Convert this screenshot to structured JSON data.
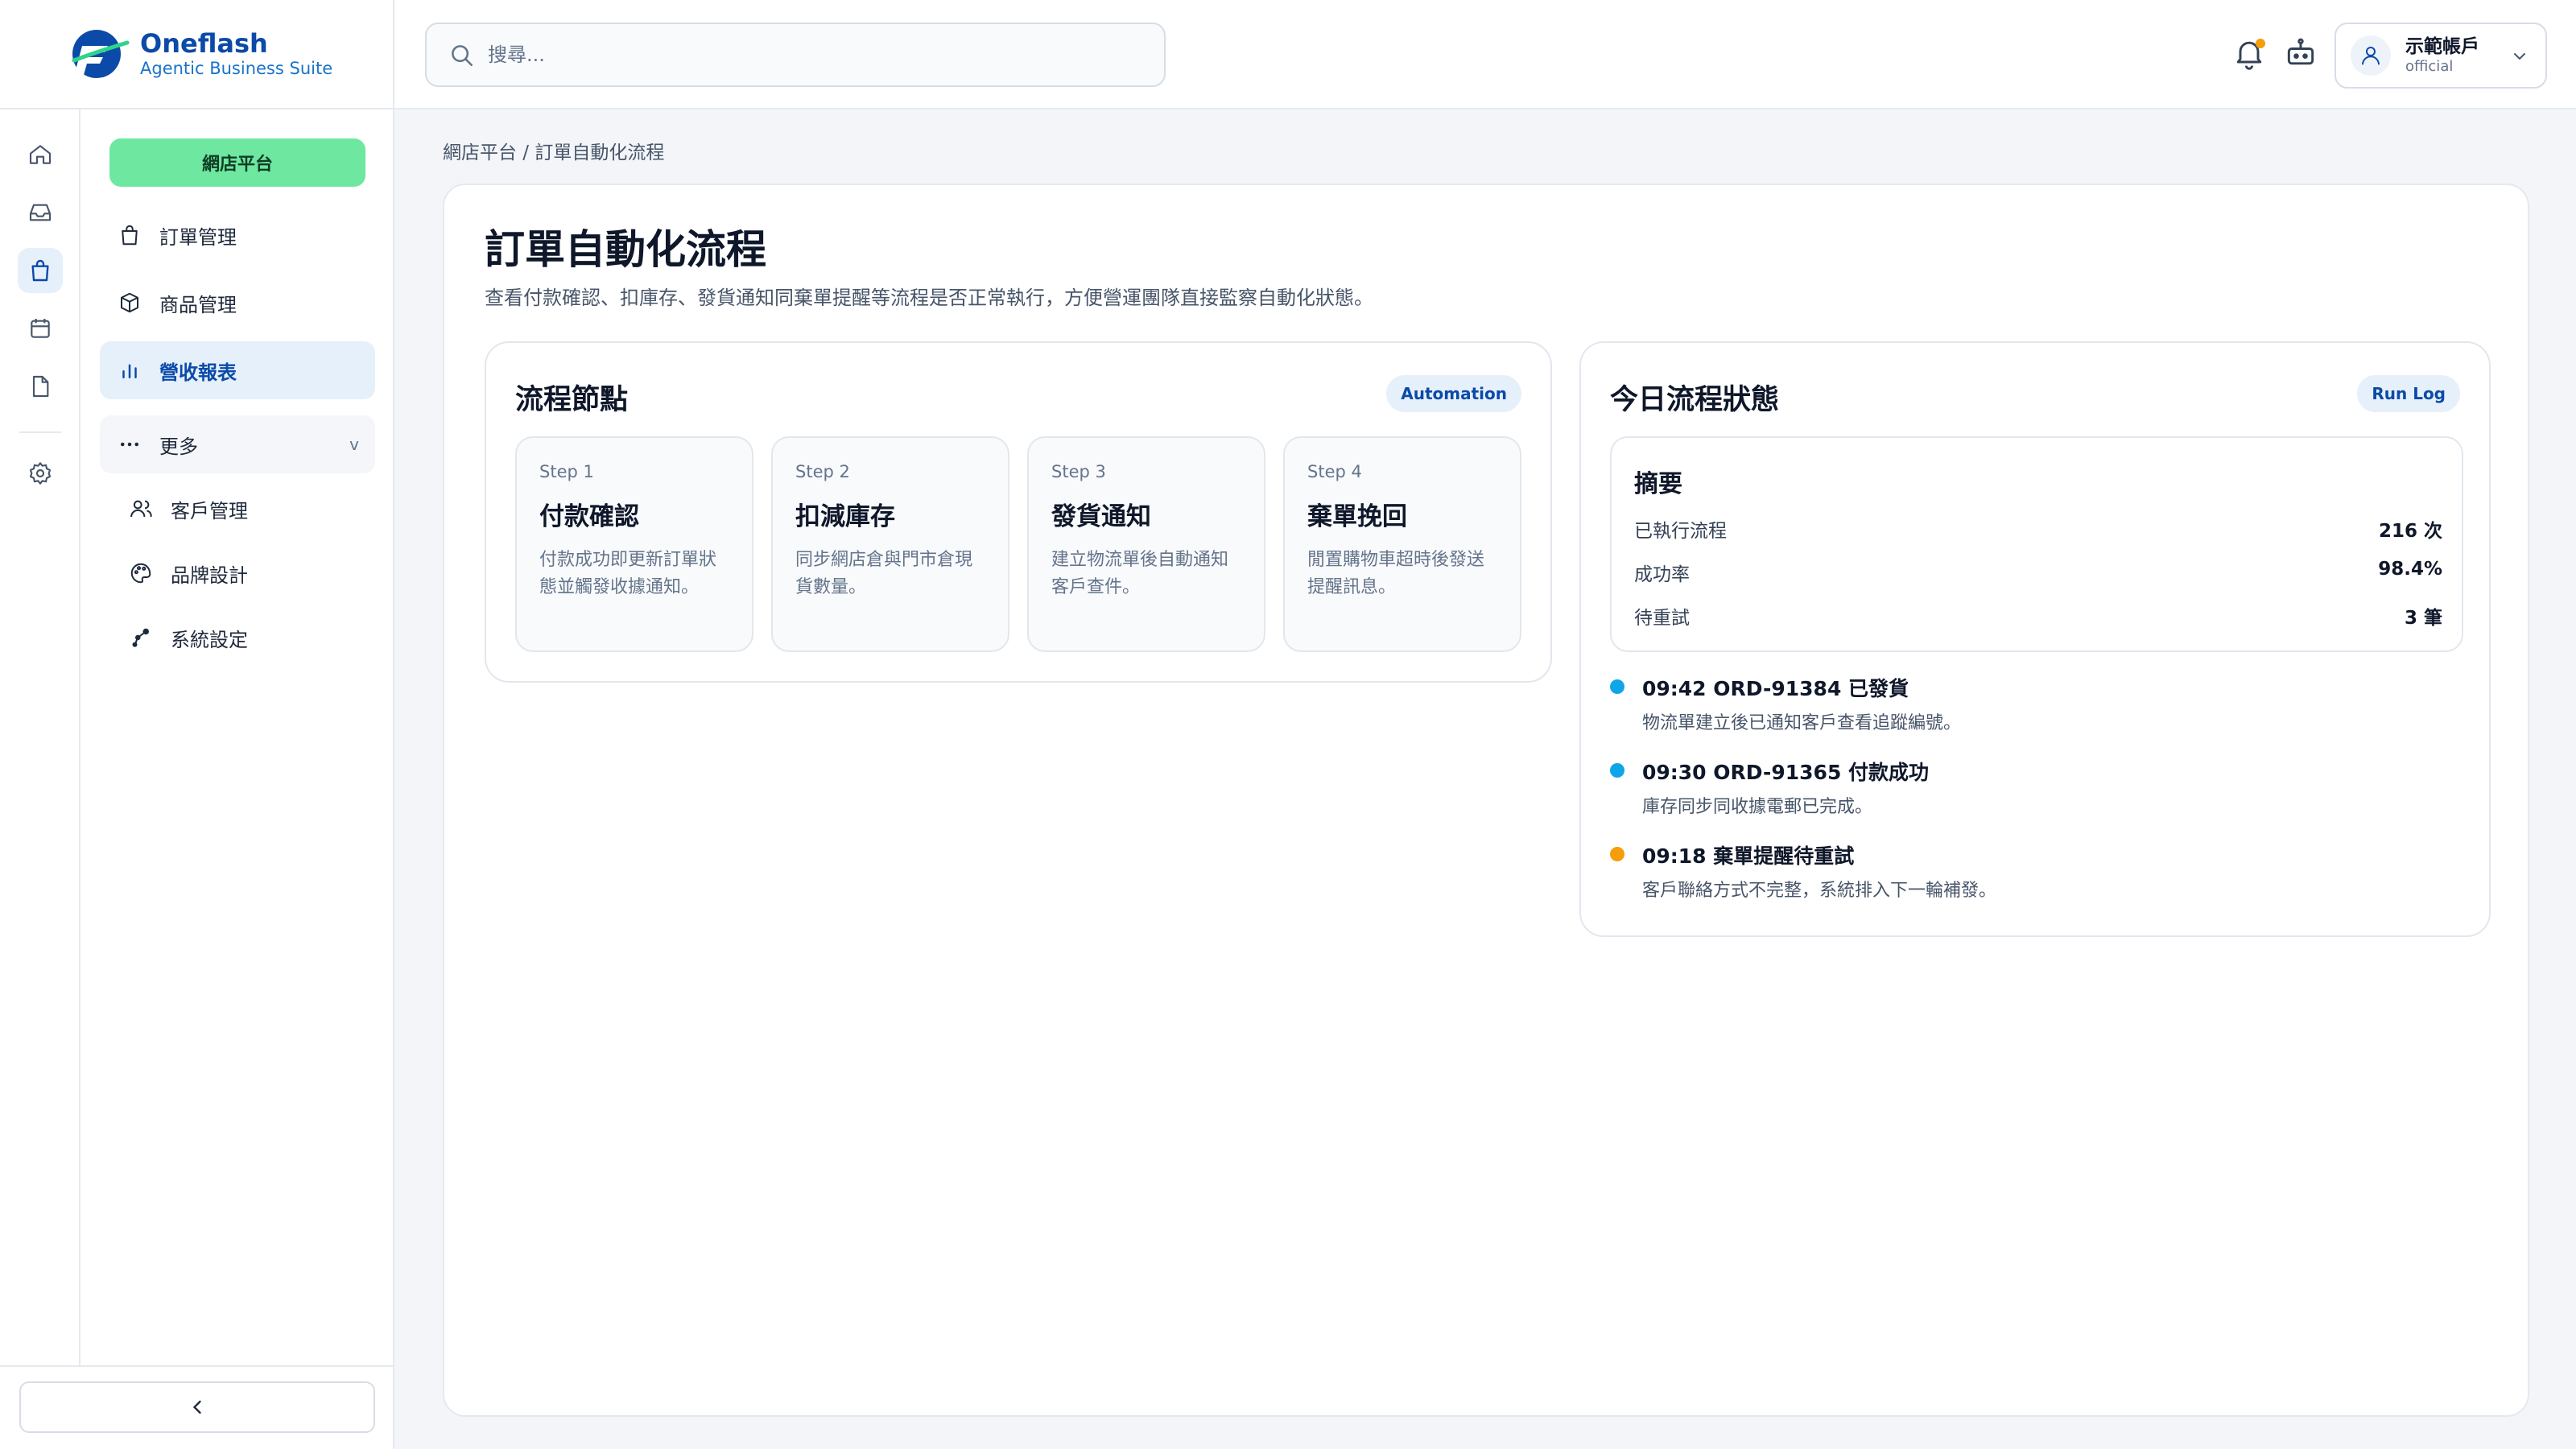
{
  "brand": {
    "name": "Oneflash",
    "tagline": "Agentic Business Suite"
  },
  "search": {
    "placeholder": "搜尋..."
  },
  "account": {
    "name": "示範帳戶",
    "role": "official"
  },
  "nav": {
    "primary_label": "網店平台",
    "items": [
      {
        "label": "訂單管理",
        "icon": "shopping-bag-icon"
      },
      {
        "label": "商品管理",
        "icon": "box-icon"
      },
      {
        "label": "營收報表",
        "icon": "bar-chart-icon",
        "active": true
      },
      {
        "label": "更多",
        "icon": "more-dots-icon",
        "chevron": "v"
      },
      {
        "label": "客戶管理",
        "icon": "users-icon"
      },
      {
        "label": "品牌設計",
        "icon": "palette-icon"
      },
      {
        "label": "系統設定",
        "icon": "settings-share-icon"
      }
    ]
  },
  "rail": [
    "home-icon",
    "inbox-icon",
    "shopping-bag-icon",
    "calendar-icon",
    "file-icon",
    "gear-icon"
  ],
  "breadcrumb": "網店平台 / 訂單自動化流程",
  "page": {
    "title": "訂單自動化流程",
    "subtitle": "查看付款確認、扣庫存、發貨通知同棄單提醒等流程是否正常執行，方便營運團隊直接監察自動化狀態。"
  },
  "flow": {
    "title": "流程節點",
    "badge": "Automation",
    "steps": [
      {
        "num": "Step 1",
        "title": "付款確認",
        "desc": "付款成功即更新訂單狀態並觸發收據通知。"
      },
      {
        "num": "Step 2",
        "title": "扣減庫存",
        "desc": "同步網店倉與門市倉現貨數量。"
      },
      {
        "num": "Step 3",
        "title": "發貨通知",
        "desc": "建立物流單後自動通知客戶查件。"
      },
      {
        "num": "Step 4",
        "title": "棄單挽回",
        "desc": "閒置購物車超時後發送提醒訊息。"
      }
    ]
  },
  "status": {
    "title": "今日流程狀態",
    "badge": "Run Log",
    "summary_title": "摘要",
    "summary": [
      {
        "label": "已執行流程",
        "value": "216 次"
      },
      {
        "label": "成功率",
        "value": "98.4%"
      },
      {
        "label": "待重試",
        "value": "3 筆"
      }
    ],
    "events": [
      {
        "title": "09:42 ORD-91384 已發貨",
        "desc": "物流單建立後已通知客戶查看追蹤編號。",
        "color": "#0ea5e9"
      },
      {
        "title": "09:30 ORD-91365 付款成功",
        "desc": "庫存同步同收據電郵已完成。",
        "color": "#0ea5e9"
      },
      {
        "title": "09:18 棄單提醒待重試",
        "desc": "客戶聯絡方式不完整，系統排入下一輪補發。",
        "color": "#f59e0b"
      }
    ]
  },
  "colors": {
    "accent": "#0b4aa8",
    "primary_button": "#6ee7a0",
    "active_bg": "#e6f0fb"
  }
}
